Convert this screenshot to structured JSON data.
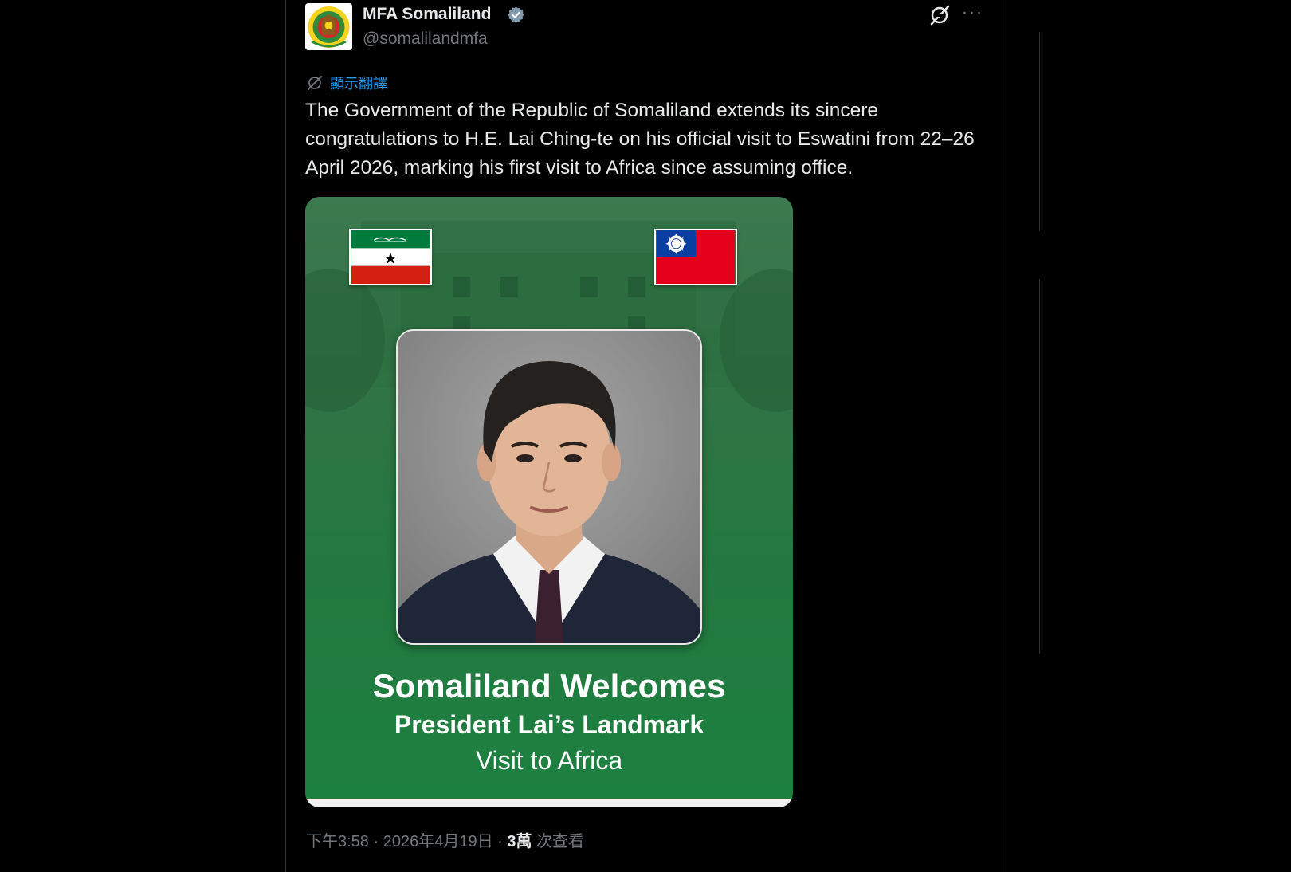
{
  "author": {
    "display_name": "MFA Somaliland",
    "handle": "@somalilandmfa"
  },
  "translate_label": "顯示翻譯",
  "post_text": "The Government of the Republic of Somaliland extends its sincere congratulations to H.E. Lai Ching-te on his official visit to Eswatini from 22–26 April 2026, marking his first visit to Africa since assuming office.",
  "image": {
    "headline": "Somaliland Welcomes",
    "subheadline": "President Lai’s Landmark",
    "subheadline2": "Visit to Africa",
    "flag_left": "Somaliland flag",
    "flag_right": "Taiwan flag"
  },
  "meta": {
    "time": "下午3:58",
    "separator": " · ",
    "date": "2026年4月19日",
    "views_count": "3萬",
    "views_label": " 次查看"
  },
  "icons": {
    "verified": "verified-badge-icon",
    "grok": "grok-icon",
    "more": "more-icon",
    "translate": "translate-icon"
  },
  "colors": {
    "accent": "#1d9bf0",
    "secondary_text": "#71767b",
    "banner_green": "#1c8140"
  }
}
